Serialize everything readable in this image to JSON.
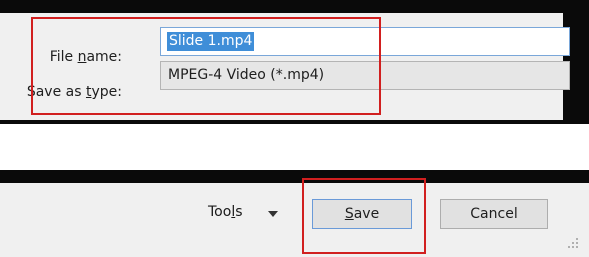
{
  "form": {
    "file_name_label": {
      "pre": "File ",
      "key": "n",
      "post": "ame:"
    },
    "file_name_value": "Slide 1.mp4",
    "save_type_label": {
      "pre": "Save as ",
      "key": "t",
      "post": "ype:"
    },
    "save_type_value": "MPEG-4 Video (*.mp4)"
  },
  "footer": {
    "tools_label": {
      "pre": "Too",
      "key": "l",
      "post": "s"
    },
    "save_label": {
      "key": "S",
      "post": "ave"
    },
    "cancel_label": "Cancel"
  },
  "colors": {
    "highlight": "#d11f1f",
    "selection": "#3f8ed8",
    "panel": "#f0f0f0"
  },
  "icons": [
    "chevron-down-icon",
    "resize-grip-icon"
  ]
}
